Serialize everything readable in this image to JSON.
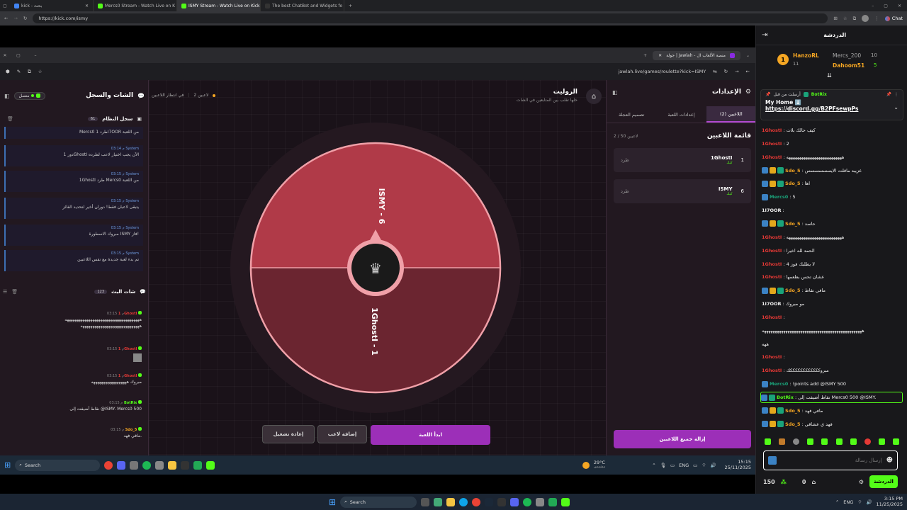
{
  "browser": {
    "tabs": [
      {
        "label": "kick - بحث",
        "active": false
      },
      {
        "label": "Mercs0 Stream - Watch Live on K",
        "active": false
      },
      {
        "label": "ISMY Stream - Watch Live on Kick",
        "active": true
      },
      {
        "label": "The best ChatBot and Widgets fo",
        "active": false
      }
    ],
    "url": "https://kick.com/ismy",
    "chat_label": "Chat"
  },
  "inner_browser": {
    "tab_title": "جولة | Jawlah - منصة الألعاب ال",
    "url": "jawlah.live/games/roulette?kick=ISMY"
  },
  "left_panel": {
    "title": "الشات والسجل",
    "connected": "متصل",
    "system_log": {
      "title": "سجل النظام",
      "count": "61",
      "items": [
        {
          "time": "",
          "msg": "Mercs0 طرد 1I7OOR من اللعبة"
        },
        {
          "time": "03:14 م",
          "msg": "دور 1GhostI الآن يجب اختيار لاعب لطرده"
        },
        {
          "time": "03:15 م",
          "msg": "1GhostI طرد Mercs0 من اللعبة"
        },
        {
          "time": "03:15 م",
          "msg": "يتبقى لاعبان فقط! دوران أخير لتحديد الفائز"
        },
        {
          "time": "03:15 م",
          "msg": "مبروك الاسطورة ISMY فاز!"
        },
        {
          "time": "03:15 م",
          "msg": "تم بدء لعبة جديدة مع نفس اللاعبين"
        }
      ],
      "system_label": "System"
    },
    "stream_chat": {
      "title": "شات البث",
      "count": "123",
      "items": [
        {
          "user": "1GhostI",
          "time": "03:15 م",
          "msg": "ههههههههههههههههههههههههههههههههههههههه",
          "color": "#e53935"
        },
        {
          "user": "1GhostI",
          "time": "03:15 م",
          "msg": "",
          "color": "#e53935"
        },
        {
          "user": "1GhostI",
          "time": "03:15 م",
          "msg": "مبروك ههههههههههههههههههه",
          "color": "#e53935"
        },
        {
          "user": "BotRix",
          "time": "03:15 م",
          "msg": "نقاط أضيفت إلى @ISMY. Mercs0 500",
          "color": "#53fc18"
        },
        {
          "user": "Sdo_5",
          "time": "03:15 م",
          "msg": "مافي فهد.",
          "color": "#f5a623"
        }
      ]
    }
  },
  "center": {
    "title": "الروليت",
    "subtitle": "خلها تقلب بين المتابعين في الشات",
    "players_count": "2 لاعبين",
    "status": "في انتظار اللاعبين",
    "wheel": {
      "segments": [
        {
          "label": "ISMY - 6",
          "color": "#b03a48"
        },
        {
          "label": "1GhostI - 1",
          "color": "#6b2530"
        }
      ]
    },
    "buttons": {
      "start": "ابدأ اللعبة",
      "add_player": "إضافة لاعب",
      "restart": "إعادة تشغيل"
    }
  },
  "right_panel": {
    "title": "الإعدادات",
    "tabs": [
      "اللاعبين (2)",
      "إعدادات اللعبة",
      "تصميم العجلة"
    ],
    "list_title": "قائمة اللاعبين",
    "list_count": "2 / 50 لاعبين",
    "players": [
      {
        "num": "1",
        "name": "1GhostI",
        "sub": "كيك",
        "kick": "طرد"
      },
      {
        "num": "6",
        "name": "ISMY",
        "sub": "كيك",
        "kick": "طرد"
      }
    ],
    "remove_all": "إزالة جميع اللاعبين"
  },
  "taskbar_inner": {
    "search": "Search",
    "weather": "29°C",
    "weather_sub": "مشمس",
    "lang": "ENG",
    "time": "15:15",
    "date": "25/11/2025"
  },
  "taskbar_outer": {
    "search": "Search",
    "lang": "ENG",
    "time": "3:15 PM",
    "date": "11/25/2025"
  },
  "kick_chat": {
    "title": "الدردشة",
    "leaders": [
      {
        "name": "HanzoRL",
        "points": "11",
        "rank": "1",
        "color": "#f5a623"
      },
      {
        "name": "Mercs_200",
        "points": "10",
        "color": "#aaa"
      },
      {
        "name": "Dahoom51",
        "points": "5",
        "color": "#f5a623"
      }
    ],
    "pinned": {
      "pinned_by": "أرسلت من قبل",
      "user": "BotRix",
      "text": "My Home ⬇️",
      "link": "https://discord.gg/B2PFsewpPs"
    },
    "messages": [
      {
        "user": "1GhostI",
        "msg": "كيف حالك بلات",
        "color": "#e53935",
        "badges": 0
      },
      {
        "user": "1GhostI",
        "msg": "2",
        "color": "#e53935",
        "badges": 0
      },
      {
        "user": "1GhostI",
        "msg": "ههههههههههههههههههههههههههه",
        "color": "#e53935",
        "badges": 0
      },
      {
        "user": "Sdo_5",
        "msg": "عزيبه ماقلت الايسسسسسس",
        "color": "#f5a623",
        "badges": 3
      },
      {
        "user": "Sdo_5",
        "msg": "اها",
        "color": "#f5a623",
        "badges": 3
      },
      {
        "user": "Mercs0",
        "msg": "5",
        "color": "#1aa37a",
        "badges": 1
      },
      {
        "user": "1I7OOR",
        "msg": "",
        "color": "#eee",
        "badges": 0
      },
      {
        "user": "Sdo_5",
        "msg": "حاسد",
        "color": "#f5a623",
        "badges": 3
      },
      {
        "user": "1GhostI",
        "msg": "ههههههههههههههههههههههههههه",
        "color": "#e53935",
        "badges": 0
      },
      {
        "user": "1GhostI",
        "msg": "الحمد لله اخيرا",
        "color": "#e53935",
        "badges": 0
      },
      {
        "user": "1GhostI",
        "msg": "لا يطلبك فوز 4",
        "color": "#e53935",
        "badges": 0
      },
      {
        "user": "1GhostI",
        "msg": "عشان تحس بطعمها",
        "color": "#e53935",
        "badges": 0
      },
      {
        "user": "Sdo_5",
        "msg": "مافي نقاط",
        "color": "#f5a623",
        "badges": 3
      },
      {
        "user": "1I7OOR",
        "msg": "مو مبروك",
        "color": "#eee",
        "badges": 0
      },
      {
        "user": "1GhostI",
        "msg": "",
        "color": "#e53935",
        "badges": 0
      },
      {
        "user": "",
        "msg": "هههههههههههههههههههههههههههههههههههههههههههههههه",
        "color": "#eee",
        "badges": 0
      },
      {
        "user": "",
        "msg": "ههه",
        "color": "#eee",
        "badges": 0
      },
      {
        "user": "1GhostI",
        "msg": "",
        "color": "#e53935",
        "badges": 0
      },
      {
        "user": "1GhostI",
        "msg": "مبروككككككككككككك",
        "color": "#e53935",
        "badges": 0
      },
      {
        "user": "Mercs0",
        "msg": "!points add @ISMY 500",
        "color": "#1aa37a",
        "badges": 1
      },
      {
        "user": "BotRix",
        "msg": "نقاط أضيفت إلى Mercs0 500 @ISMY.",
        "color": "#53fc18",
        "badges": 2
      },
      {
        "user": "Sdo_5",
        "msg": "مافي فهد",
        "color": "#f5a623",
        "badges": 3
      },
      {
        "user": "Sdo_5",
        "msg": "فهد ي عشاقي",
        "color": "#f5a623",
        "badges": 3
      }
    ],
    "input_placeholder": "إرسال رسالة",
    "points": "150",
    "count": "0",
    "chat_button": "الدردشة"
  }
}
